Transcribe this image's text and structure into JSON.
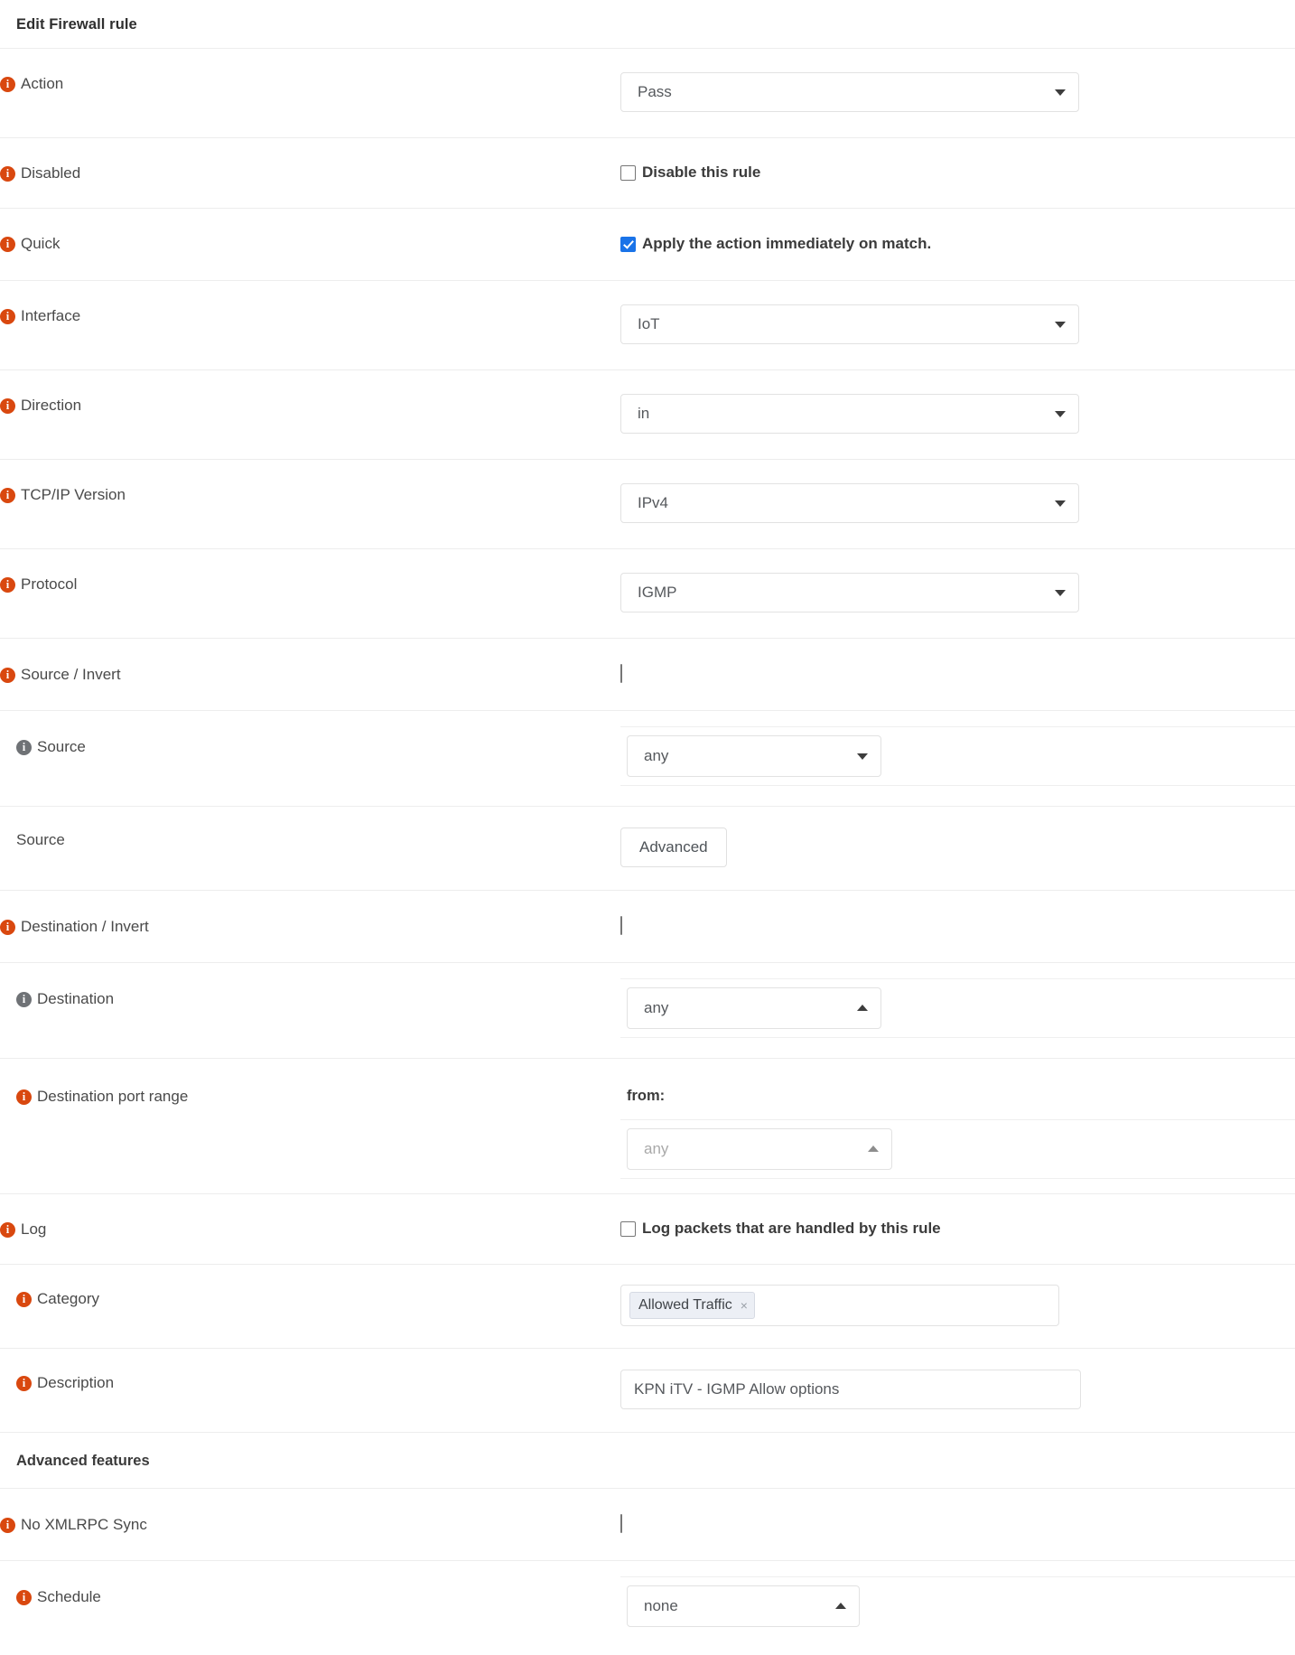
{
  "header": {
    "title": "Edit Firewall rule"
  },
  "colors": {
    "info_icon": "#d9480f",
    "info_icon_muted": "#6f7276",
    "checkbox_checked": "#1a73e8",
    "tag_background": "#eceff5",
    "border": "#e2e2e2",
    "row_separator": "#ededed"
  },
  "rows": {
    "action": {
      "label": "Action",
      "value": "Pass"
    },
    "disabled": {
      "label": "Disabled",
      "checkbox_label": "Disable this rule",
      "checked": false
    },
    "quick": {
      "label": "Quick",
      "checkbox_label": "Apply the action immediately on match.",
      "checked": true
    },
    "interface": {
      "label": "Interface",
      "value": "IoT"
    },
    "direction": {
      "label": "Direction",
      "value": "in"
    },
    "tcpip": {
      "label": "TCP/IP Version",
      "value": "IPv4"
    },
    "protocol": {
      "label": "Protocol",
      "value": "IGMP"
    },
    "source_invert": {
      "label": "Source / Invert",
      "checked": false
    },
    "source": {
      "label": "Source",
      "value": "any"
    },
    "source_adv": {
      "label": "Source",
      "button": "Advanced"
    },
    "dest_invert": {
      "label": "Destination / Invert",
      "checked": false
    },
    "destination": {
      "label": "Destination",
      "value": "any"
    },
    "dest_port": {
      "label": "Destination port range",
      "from_label": "from:",
      "from_placeholder": "any"
    },
    "log": {
      "label": "Log",
      "checkbox_label": "Log packets that are handled by this rule",
      "checked": false
    },
    "category": {
      "label": "Category",
      "tags": [
        "Allowed Traffic"
      ],
      "remove_glyph": "×"
    },
    "description": {
      "label": "Description",
      "value": "KPN iTV - IGMP Allow options",
      "placeholder": "Description"
    },
    "advanced_head": {
      "label": "Advanced features"
    },
    "no_xmlrpc": {
      "label": "No XMLRPC Sync",
      "checked": false
    },
    "schedule": {
      "label": "Schedule",
      "value": "none"
    }
  },
  "icons": {
    "info": "i",
    "caret_down": "chevron-down-icon",
    "caret_up": "chevron-up-icon"
  }
}
